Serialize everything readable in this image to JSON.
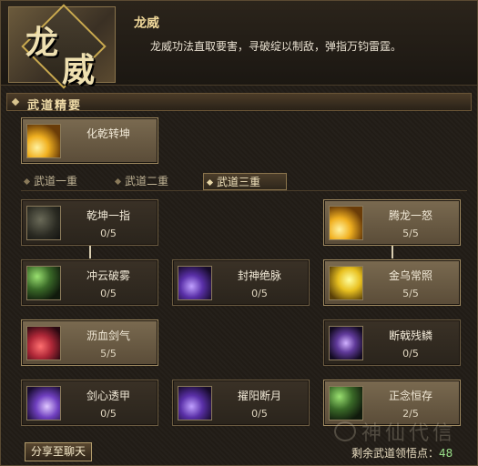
{
  "header": {
    "emblem_chars": [
      "龙",
      "威"
    ],
    "title": "龙威",
    "description": "龙威功法直取要害，寻破绽以制敌，弹指万钧雷霆。"
  },
  "section": {
    "title": "武道精要"
  },
  "featured": {
    "name": "化乾转坤",
    "icon": "gold-fist-icon"
  },
  "tabs": [
    {
      "label": "武道一重",
      "active": false
    },
    {
      "label": "武道二重",
      "active": false
    },
    {
      "label": "武道三重",
      "active": true
    }
  ],
  "skills": [
    {
      "name": "乾坤一指",
      "level": "0/5",
      "icon": "dark-finger-icon",
      "active": false
    },
    {
      "name": "腾龙一怒",
      "level": "5/5",
      "icon": "gold-dragon-icon",
      "active": true
    },
    {
      "name": "冲云破雾",
      "level": "0/5",
      "icon": "green-cloud-icon",
      "active": false
    },
    {
      "name": "封神绝脉",
      "level": "0/5",
      "icon": "purple-seal-icon",
      "active": false
    },
    {
      "name": "金乌常照",
      "level": "5/5",
      "icon": "gold-sun-icon",
      "active": true
    },
    {
      "name": "沥血剑气",
      "level": "5/5",
      "icon": "red-sword-icon",
      "active": true
    },
    {
      "name": "断戟残鳞",
      "level": "0/5",
      "icon": "ghost-halberd-icon",
      "active": false
    },
    {
      "name": "剑心透甲",
      "level": "0/5",
      "icon": "violet-blade-icon",
      "active": false
    },
    {
      "name": "擢阳断月",
      "level": "0/5",
      "icon": "violet-moon-icon",
      "active": false
    },
    {
      "name": "正念恒存",
      "level": "2/5",
      "icon": "green-mind-icon",
      "active": true
    }
  ],
  "footer": {
    "share_label": "分享至聊天",
    "remain_label": "剩余武道领悟点：",
    "remain_value": "48",
    "watermark": "神仙代信"
  }
}
